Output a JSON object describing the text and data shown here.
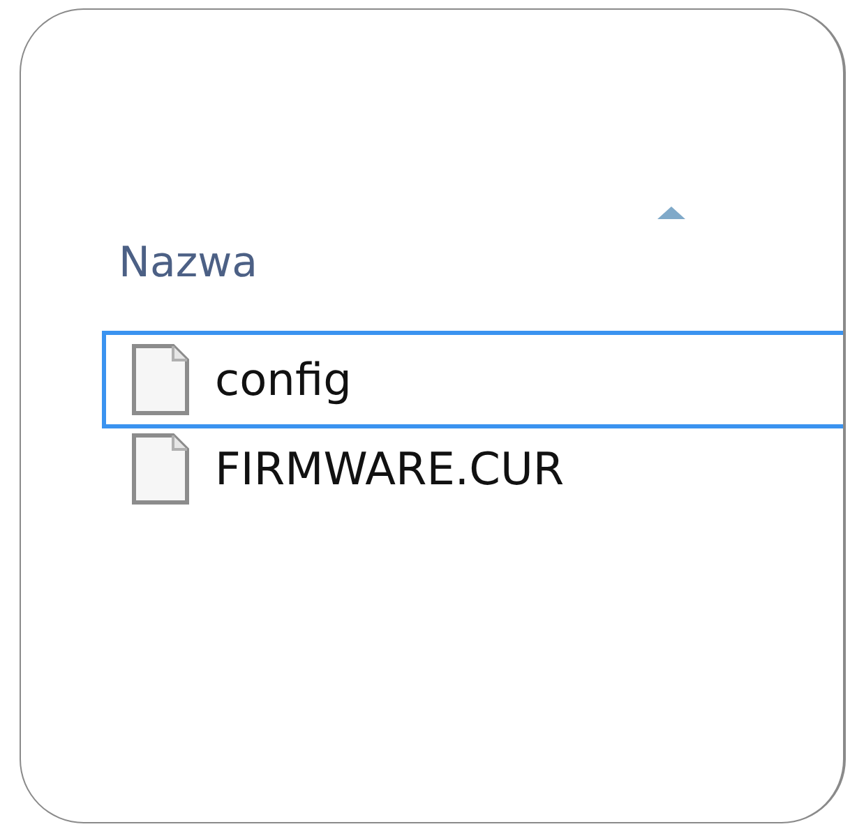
{
  "header": {
    "label": "Nazwa",
    "sort_ascending": true
  },
  "files": [
    {
      "name": "config",
      "selected": true
    },
    {
      "name": "FIRMWARE.CUR",
      "selected": false
    }
  ]
}
